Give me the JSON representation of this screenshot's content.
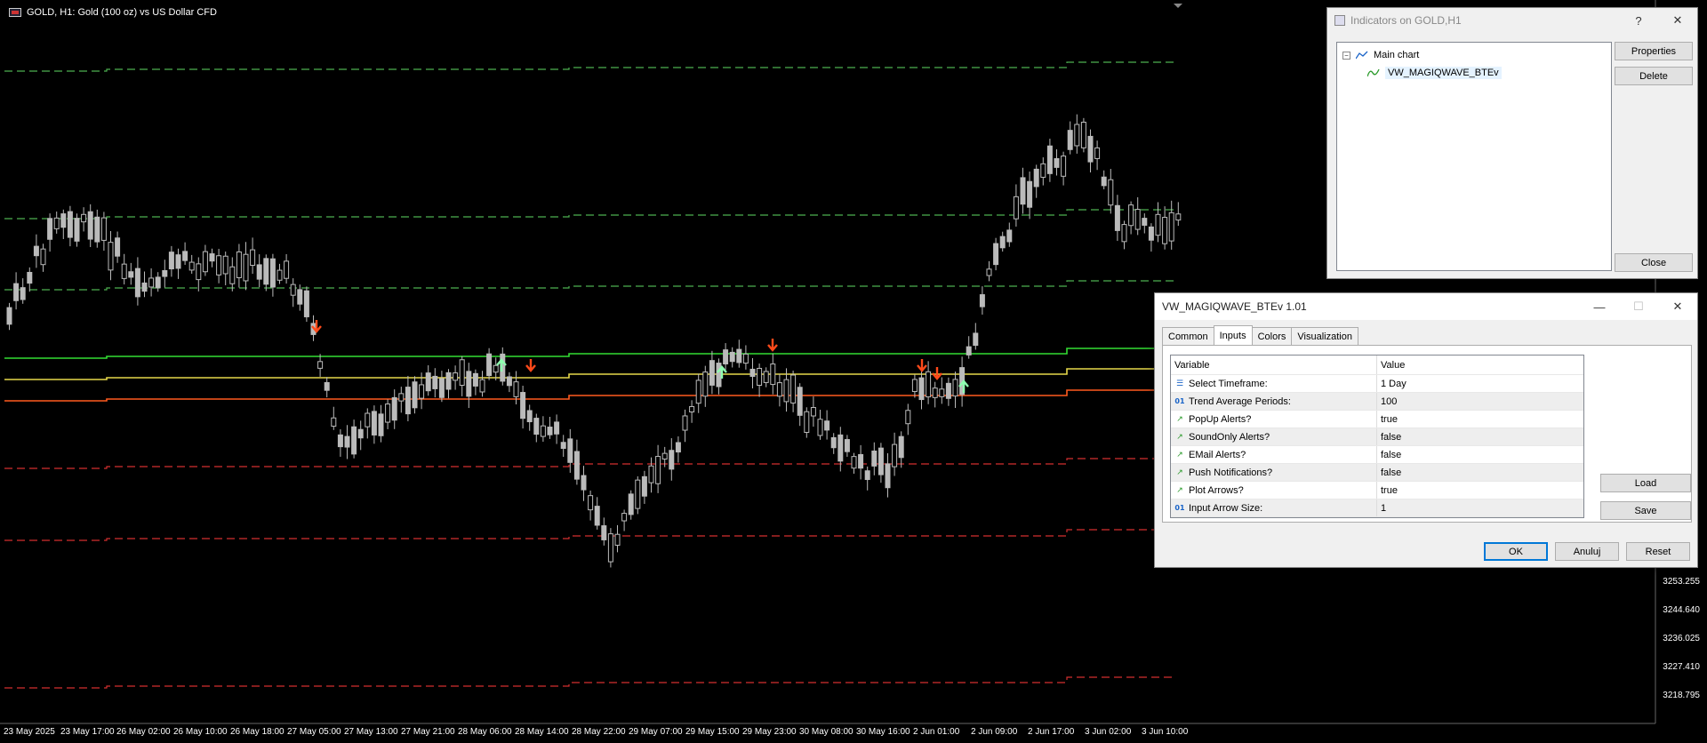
{
  "chart": {
    "title": "GOLD, H1:  Gold (100 oz) vs US Dollar CFD",
    "price_labels": [
      "3253.255",
      "3244.640",
      "3236.025",
      "3227.410",
      "3218.795"
    ],
    "time_labels": [
      "23 May 2025",
      "23 May 17:00",
      "26 May 02:00",
      "26 May 10:00",
      "26 May 18:00",
      "27 May 05:00",
      "27 May 13:00",
      "27 May 21:00",
      "28 May 06:00",
      "28 May 14:00",
      "28 May 22:00",
      "29 May 07:00",
      "29 May 15:00",
      "29 May 23:00",
      "30 May 08:00",
      "30 May 16:00",
      "2 Jun 01:00",
      "2 Jun 09:00",
      "2 Jun 17:00",
      "3 Jun 02:00",
      "3 Jun 10:00"
    ],
    "colors": {
      "upper_band": "#4caf50",
      "lower_band": "#d32f2f",
      "green_line": "#33dd33",
      "yellow_line": "#e6d84a",
      "red_line": "#ff5a1f",
      "up_arrow": "#8fffb0",
      "down_arrow": "#ff4a1a",
      "candle": "#bbbbbb"
    }
  },
  "indicators_window": {
    "title": "Indicators on GOLD,H1",
    "help": "?",
    "close_x": "✕",
    "tree_root": "Main chart",
    "tree_child": "VW_MAGIQWAVE_BTEv",
    "properties_label": "Properties",
    "delete_label": "Delete",
    "close_label": "Close"
  },
  "props_window": {
    "title": "VW_MAGIQWAVE_BTEv 1.01",
    "minimize": "—",
    "maximize": "☐",
    "close_x": "✕",
    "tabs": [
      "Common",
      "Inputs",
      "Colors",
      "Visualization"
    ],
    "active_tab": "Inputs",
    "col_variable": "Variable",
    "col_value": "Value",
    "params": [
      {
        "name": "Select Timeframe:",
        "value": "1 Day",
        "icon": "enum-icon"
      },
      {
        "name": "Trend Average Periods:",
        "value": "100",
        "icon": "number-icon"
      },
      {
        "name": "PopUp Alerts?",
        "value": "true",
        "icon": "boolean-icon"
      },
      {
        "name": "SoundOnly Alerts?",
        "value": "false",
        "icon": "boolean-icon"
      },
      {
        "name": "EMail Alerts?",
        "value": "false",
        "icon": "boolean-icon"
      },
      {
        "name": "Push Notifications?",
        "value": "false",
        "icon": "boolean-icon"
      },
      {
        "name": "Plot Arrows?",
        "value": "true",
        "icon": "boolean-icon"
      },
      {
        "name": "Input Arrow Size:",
        "value": "1",
        "icon": "number-icon"
      }
    ],
    "load_label": "Load",
    "save_label": "Save",
    "ok_label": "OK",
    "cancel_label": "Anuluj",
    "reset_label": "Reset"
  }
}
